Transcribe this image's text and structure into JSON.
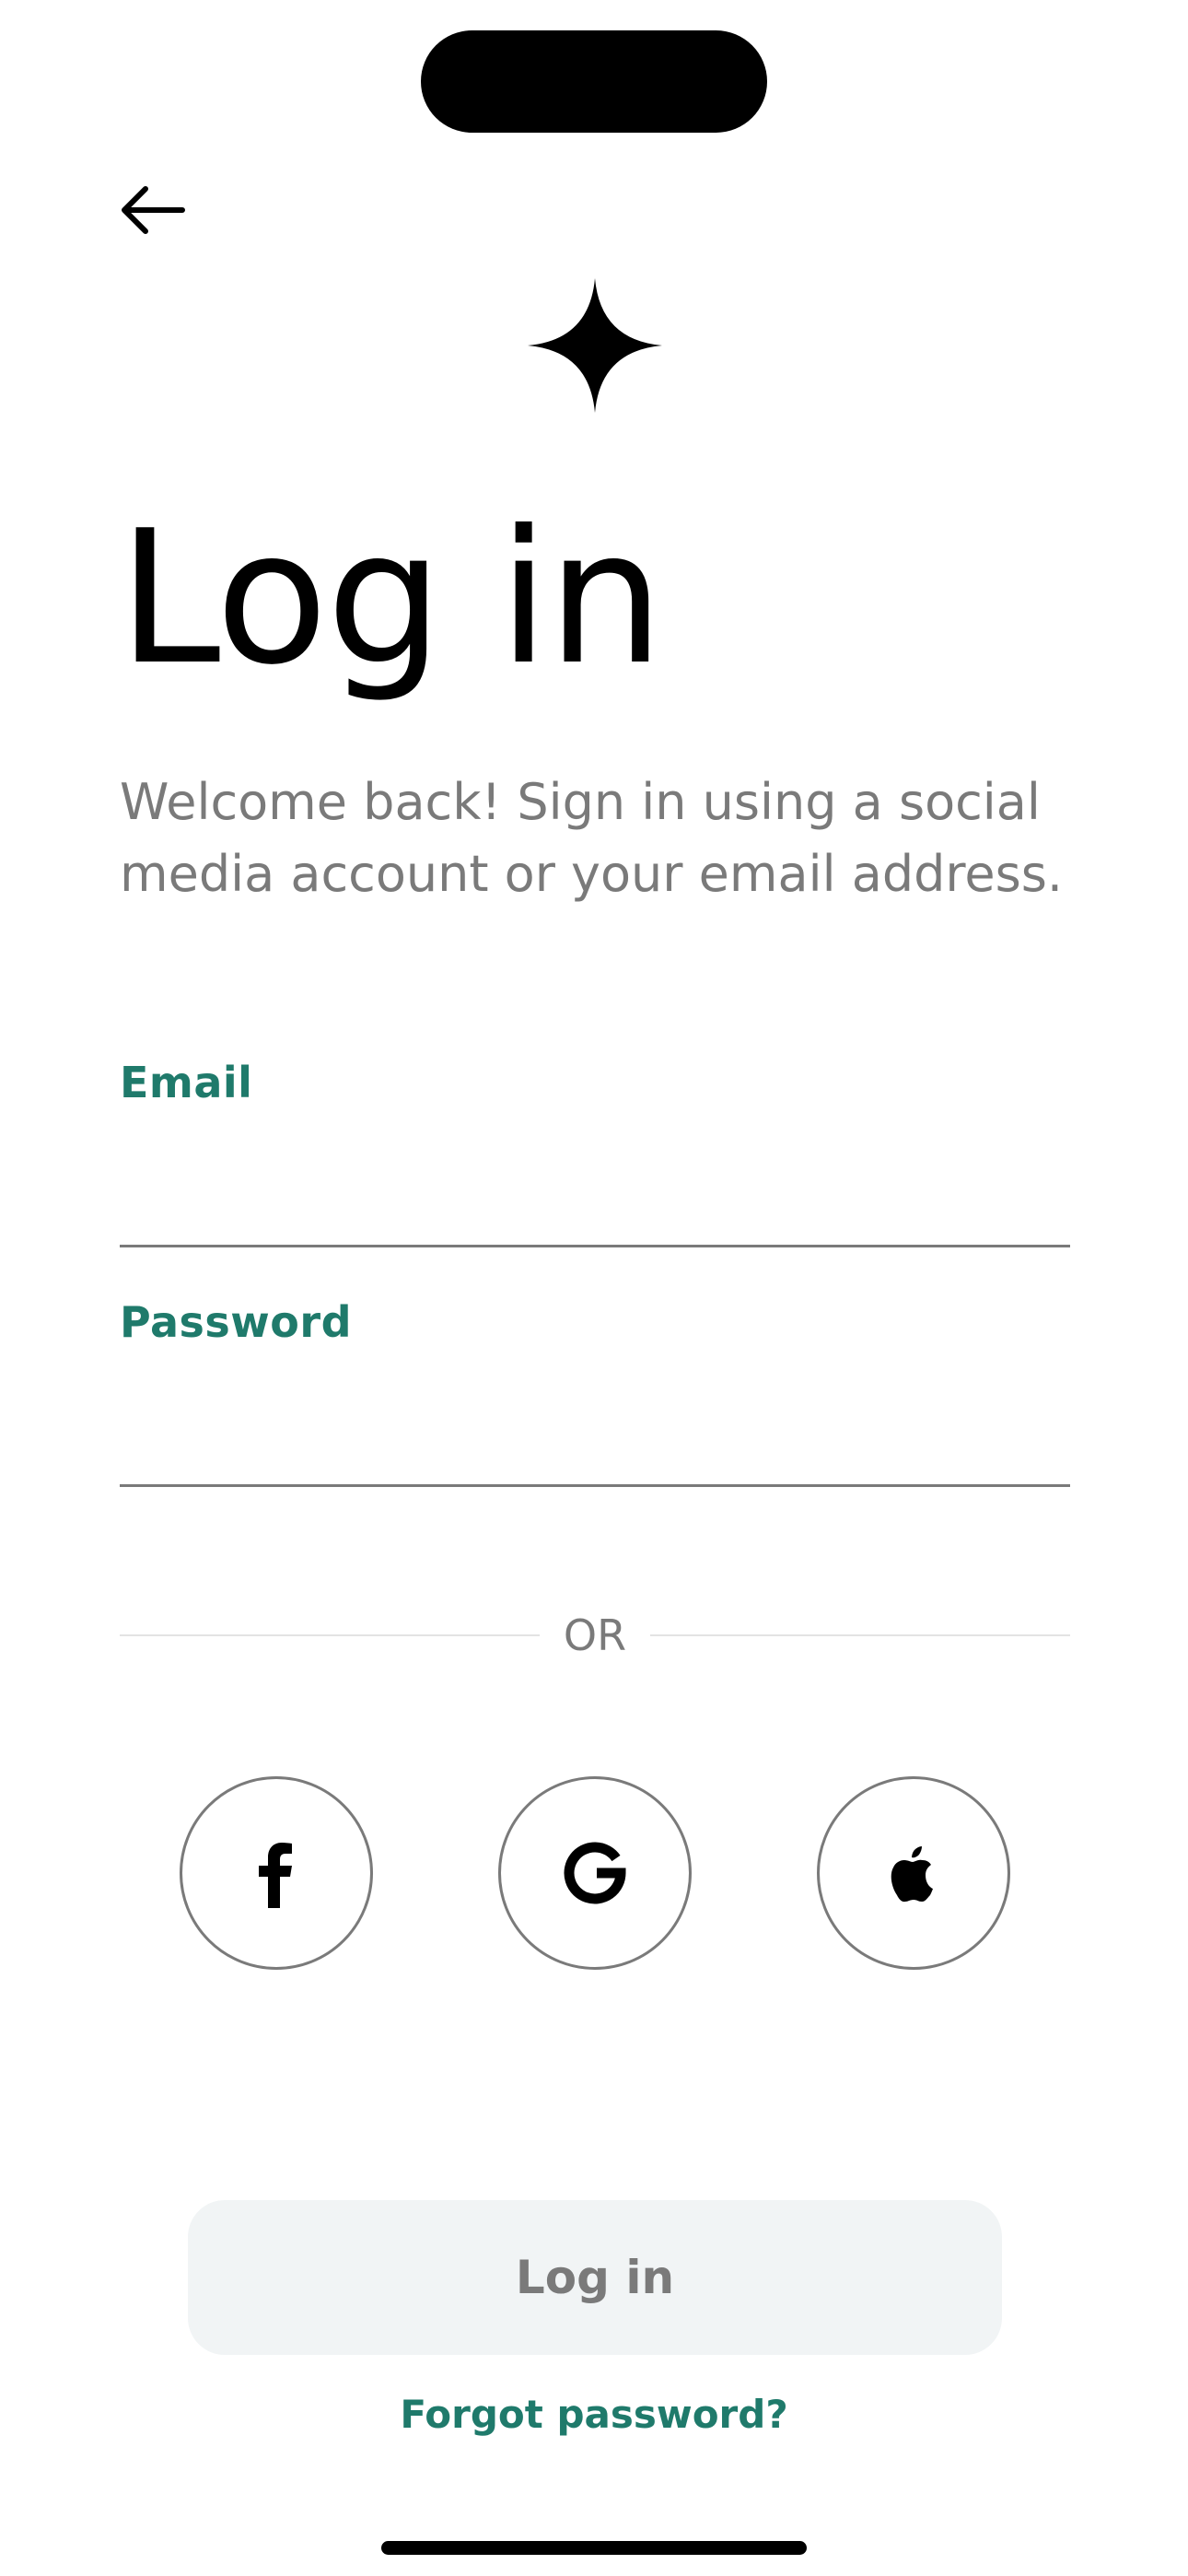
{
  "header": {
    "back_icon": "arrow-left-icon",
    "logo_icon": "four-point-star-icon"
  },
  "main": {
    "title": "Log in",
    "subtitle": "Welcome back! Sign in using a social media account or your email address."
  },
  "form": {
    "email_label": "Email",
    "email_value": "",
    "password_label": "Password",
    "password_value": ""
  },
  "divider": {
    "text": "OR"
  },
  "social": [
    {
      "name": "facebook",
      "icon": "facebook-icon"
    },
    {
      "name": "google",
      "icon": "google-icon"
    },
    {
      "name": "apple",
      "icon": "apple-icon"
    }
  ],
  "actions": {
    "login_label": "Log in",
    "forgot_label": "Forgot password?"
  },
  "colors": {
    "accent": "#1f7a6b",
    "muted_text": "#7a7a7a",
    "button_bg": "#f1f4f5"
  }
}
